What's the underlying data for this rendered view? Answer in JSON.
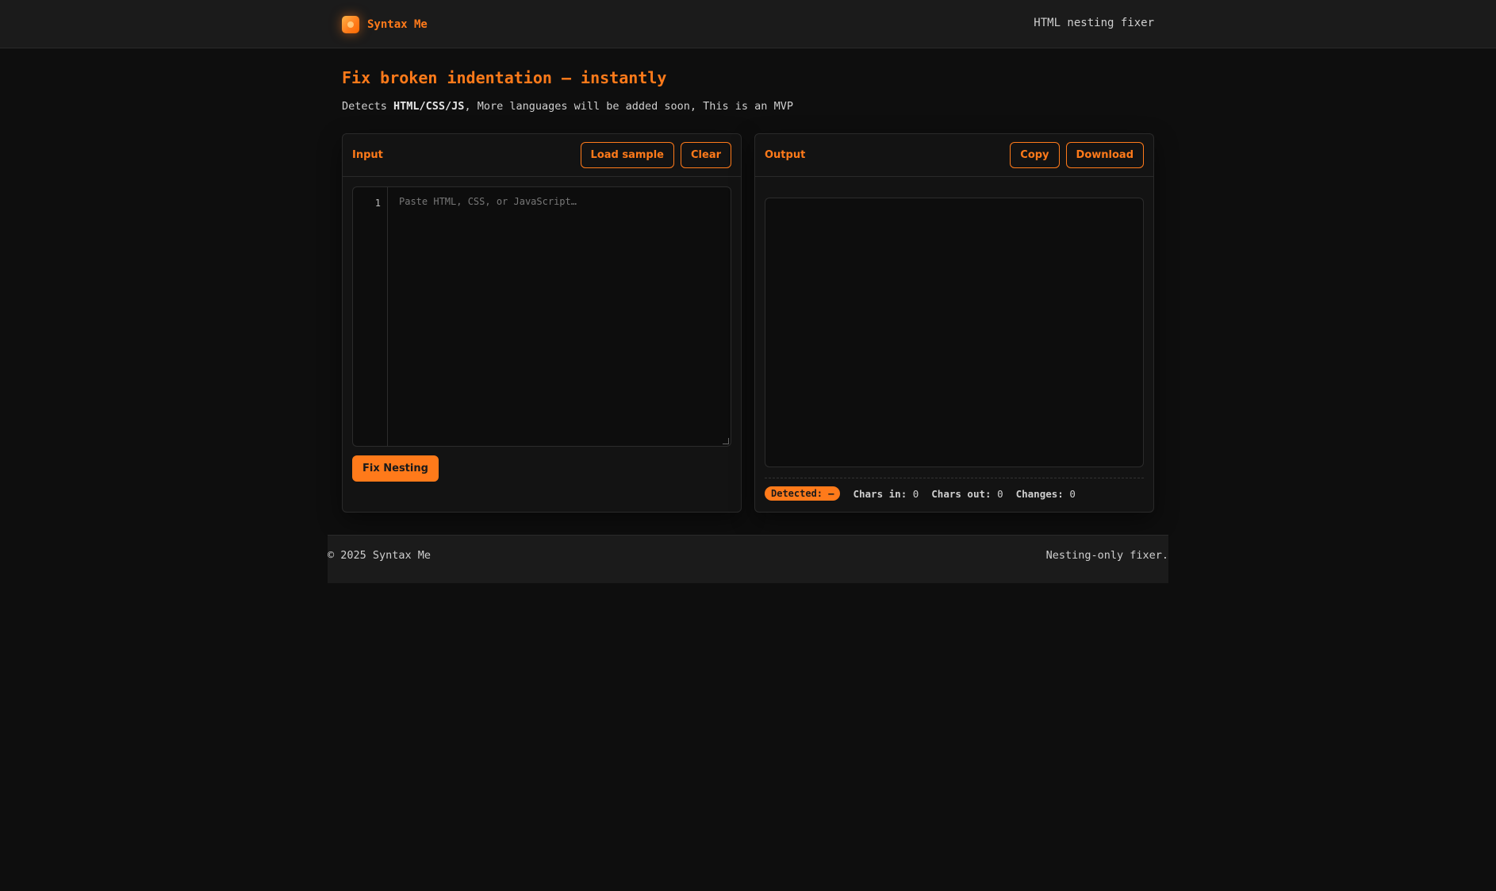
{
  "header": {
    "brand": "Syntax Me",
    "logo_icon": "flame-icon",
    "tagline": "HTML nesting fixer"
  },
  "hero": {
    "title": "Fix broken indentation — instantly",
    "subtitle_prefix": "Detects ",
    "subtitle_bold": "HTML/CSS/JS",
    "subtitle_suffix": ", More languages will be added soon, This is an MVP"
  },
  "input_panel": {
    "label": "Input",
    "load_sample_label": "Load sample",
    "clear_label": "Clear",
    "line_number": "1",
    "placeholder": "Paste HTML, CSS, or JavaScript…",
    "value": "",
    "fix_label": "Fix Nesting"
  },
  "output_panel": {
    "label": "Output",
    "copy_label": "Copy",
    "download_label": "Download",
    "content": "",
    "detected": "Detected: —",
    "chars_in_label": "Chars in:",
    "chars_in": "0",
    "chars_out_label": "Chars out:",
    "chars_out": "0",
    "changes_label": "Changes:",
    "changes": "0"
  },
  "footer": {
    "copyright": "© 2025 Syntax Me",
    "note": "Nesting-only fixer."
  },
  "colors": {
    "accent": "#ff7a1a",
    "background": "#0e0e0e",
    "surface": "#1b1b1b"
  }
}
